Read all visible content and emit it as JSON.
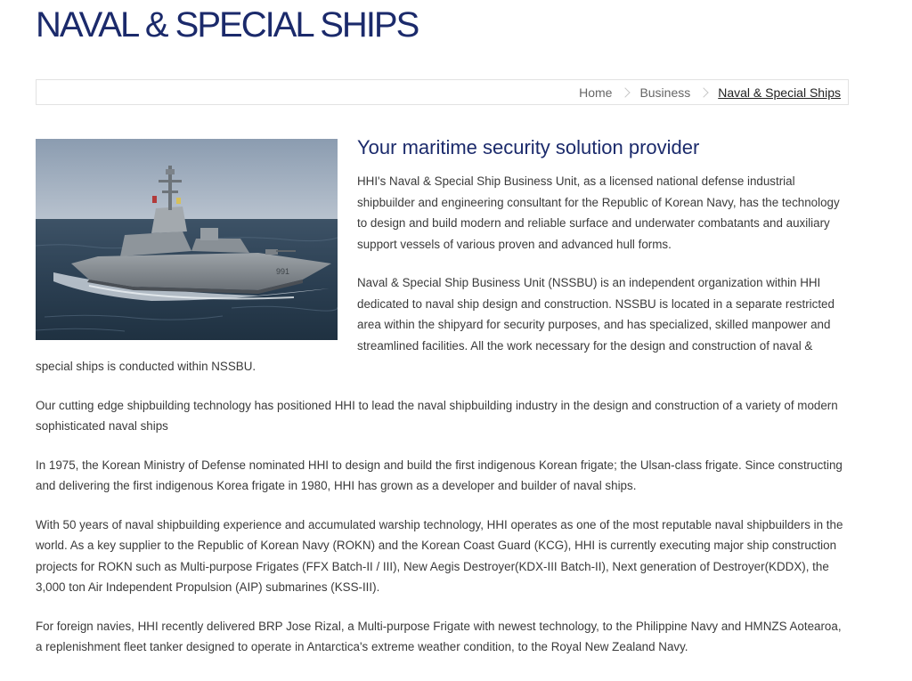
{
  "page": {
    "title": "NAVAL & SPECIAL SHIPS"
  },
  "breadcrumb": {
    "items": [
      "Home",
      "Business",
      "Naval & Special Ships"
    ]
  },
  "content": {
    "image_label": "naval destroyer photo",
    "subtitle": "Your maritime security solution provider",
    "paragraphs": [
      "HHI's Naval & Special Ship Business Unit, as a licensed national defense industrial shipbuilder and engineering consultant for the Republic of Korean Navy, has the technology to design and build modern and reliable surface and underwater combatants and auxiliary support vessels of various proven and advanced hull forms.",
      "Naval & Special Ship Business Unit (NSSBU) is an independent organization within HHI dedicated to naval ship design and construction. NSSBU is located in a separate restricted area within the shipyard for security purposes, and has specialized, skilled manpower and streamlined facilities. All the work necessary for the design and construction of naval & special ships is conducted within NSSBU.",
      "Our cutting edge shipbuilding technology has positioned HHI to lead the naval shipbuilding industry in the design and construction of a variety of modern sophisticated naval ships",
      "In 1975, the Korean Ministry of Defense nominated HHI to design and build the first indigenous Korean frigate; the Ulsan-class frigate. Since constructing and delivering the first indigenous Korea frigate in 1980, HHI has grown as a developer and builder of naval ships.",
      "With 50 years of naval shipbuilding experience and accumulated warship technology, HHI operates as one of the most reputable naval shipbuilders in the world. As a key supplier to the Republic of Korean Navy (ROKN) and the Korean Coast Guard (KCG), HHI is currently executing major ship construction projects for ROKN such as Multi-purpose Frigates (FFX Batch-II / III), New Aegis Destroyer(KDX-III Batch-II), Next generation of Destroyer(KDDX), the 3,000 ton Air Independent Propulsion (AIP) submarines (KSS-III).",
      "For foreign navies, HHI recently delivered BRP Jose Rizal, a Multi-purpose Frigate with newest technology, to the Philippine Navy and HMNZS Aotearoa, a replenishment fleet tanker designed to operate in Antarctica's extreme weather condition, to the Royal New Zealand Navy."
    ]
  },
  "colors": {
    "title": "#1b2a6b",
    "body_text": "#3a3a3a",
    "breadcrumb_text": "#666666",
    "border": "#e2e2e2"
  }
}
